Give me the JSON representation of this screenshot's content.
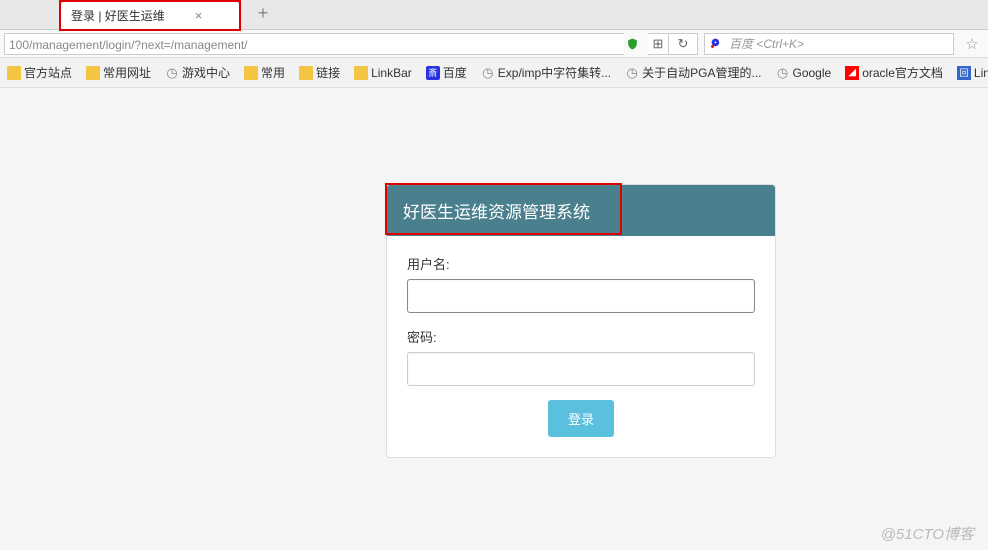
{
  "browser": {
    "tab_title": "登录 | 好医生运维",
    "url": "100/management/login/?next=/management/",
    "search_placeholder": "百度 <Ctrl+K>"
  },
  "bookmarks": [
    {
      "icon": "folder",
      "label": "官方站点"
    },
    {
      "icon": "folder",
      "label": "常用网址"
    },
    {
      "icon": "globe",
      "label": "游戏中心"
    },
    {
      "icon": "folder",
      "label": "常用"
    },
    {
      "icon": "folder",
      "label": "链接"
    },
    {
      "icon": "folder",
      "label": "LinkBar"
    },
    {
      "icon": "baidu",
      "label": "百度"
    },
    {
      "icon": "globe",
      "label": "Exp/imp中字符集转..."
    },
    {
      "icon": "globe",
      "label": "关于自动PGA管理的..."
    },
    {
      "icon": "globe",
      "label": "Google"
    },
    {
      "icon": "oracle",
      "label": "oracle官方文档"
    },
    {
      "icon": "linux",
      "label": "Linux"
    }
  ],
  "login": {
    "header": "好医生运维资源管理系统",
    "username_label": "用户名:",
    "password_label": "密码:",
    "submit_label": "登录"
  },
  "watermark": "@51CTO博客"
}
